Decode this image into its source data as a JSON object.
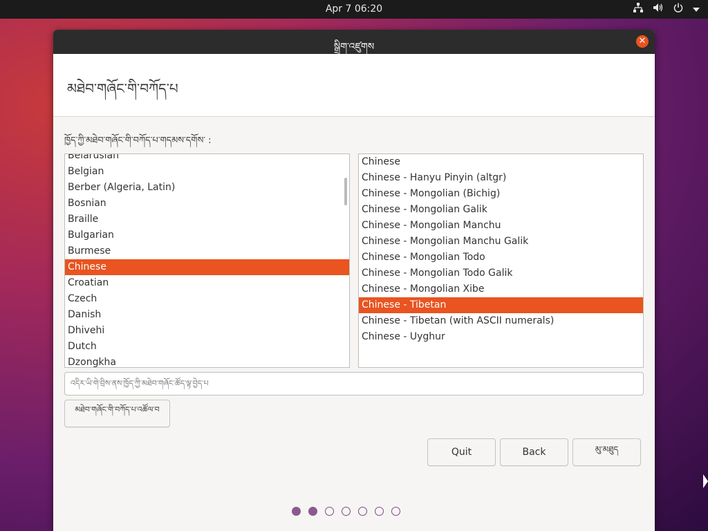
{
  "topbar": {
    "clock": "Apr 7  06:20",
    "icons": [
      "network-icon",
      "volume-icon",
      "power-icon",
      "menu-arrow-icon"
    ]
  },
  "window": {
    "title": "སྒྲིག་འཛུགས",
    "heading": "མཐེབ་གཞོང་གི་བཀོད་པ",
    "prompt": "ཁྱོད་ཀྱི་མཐེབ་གཞོང་གི་བཀོད་པ་གདམས་དགོས་ :",
    "layouts": [
      "Belarusian",
      "Belgian",
      "Berber (Algeria, Latin)",
      "Bosnian",
      "Braille",
      "Bulgarian",
      "Burmese",
      "Chinese",
      "Croatian",
      "Czech",
      "Danish",
      "Dhivehi",
      "Dutch",
      "Dzongkha"
    ],
    "selected_layout_index": 7,
    "variants": [
      "Chinese",
      "Chinese - Hanyu Pinyin (altgr)",
      "Chinese - Mongolian (Bichig)",
      "Chinese - Mongolian Galik",
      "Chinese - Mongolian Manchu",
      "Chinese - Mongolian Manchu Galik",
      "Chinese - Mongolian Todo",
      "Chinese - Mongolian Todo Galik",
      "Chinese - Mongolian Xibe",
      "Chinese - Tibetan",
      "Chinese - Tibetan (with ASCII numerals)",
      "Chinese - Uyghur"
    ],
    "selected_variant_index": 9,
    "test_placeholder": "འདིར་ཡི་གེ་བྲིས་ནས་ཁྱོད་ཀྱི་མཐེབ་གཞོང་ཚོད་ལྟ་བྱེད་པ",
    "detect_button": "མཐེབ་གཞོང་གི་བཀོད་པ་འཚོལ་བ",
    "quit_button": "Quit",
    "back_button": "Back",
    "next_button": "མུ་མཐུད",
    "progress": {
      "total_steps": 7,
      "completed_steps": 2
    },
    "accent_color": "#e95420"
  }
}
